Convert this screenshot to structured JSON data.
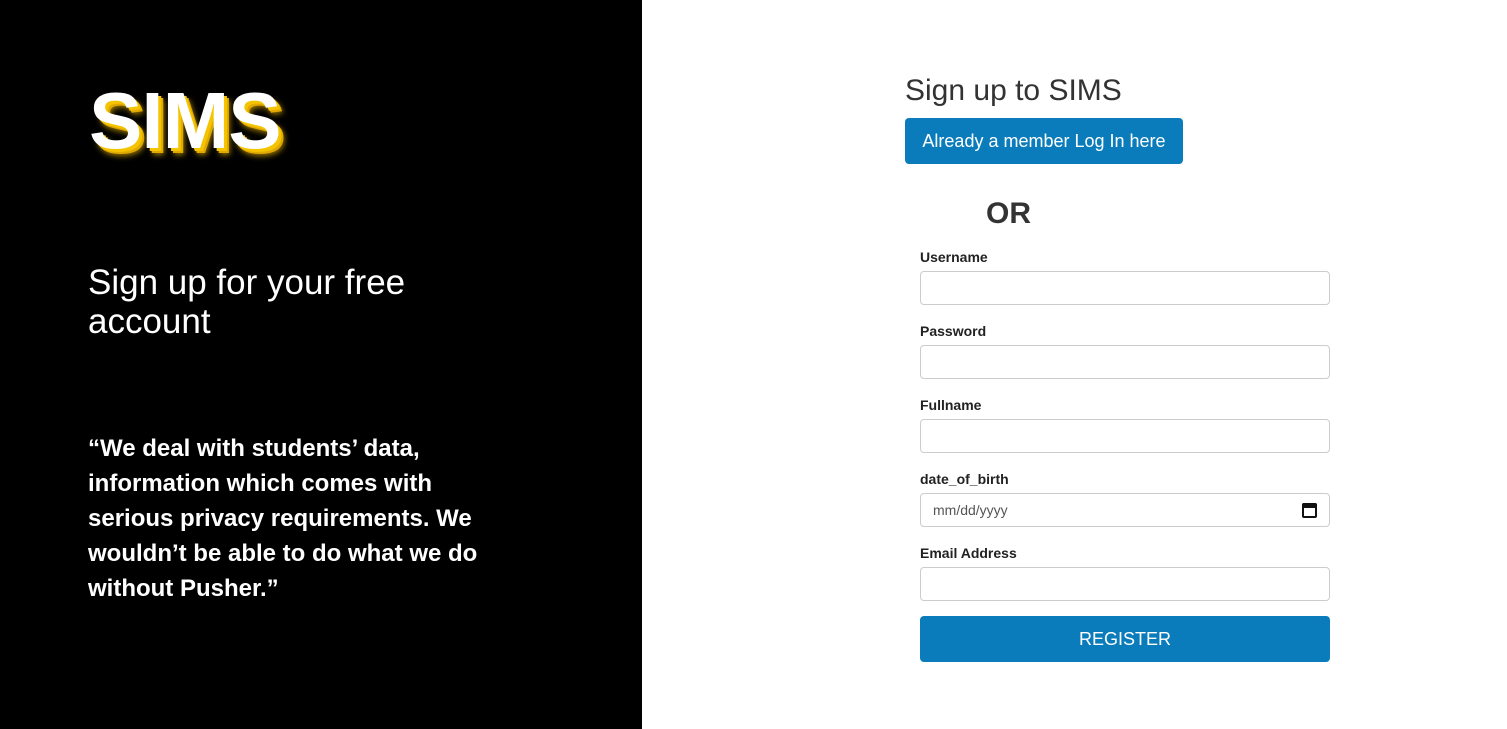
{
  "brand": {
    "logo_text": "SIMS",
    "accent_color": "#f5c400"
  },
  "left": {
    "tagline": "Sign up for your free account",
    "quote": "“We deal with students’ data, information which comes with serious privacy requirements. We wouldn’t be able to do what we do without Pusher.”"
  },
  "form": {
    "title": "Sign up to SIMS",
    "login_button": "Already a member Log In here",
    "or_label": "OR",
    "fields": {
      "username": {
        "label": "Username",
        "value": ""
      },
      "password": {
        "label": "Password",
        "value": ""
      },
      "fullname": {
        "label": "Fullname",
        "value": ""
      },
      "date_of_birth": {
        "label": "date_of_birth",
        "placeholder": "mm/dd/yyyy",
        "icon": "calendar-icon"
      },
      "email": {
        "label": "Email Address",
        "value": ""
      }
    },
    "register_button": "REGISTER",
    "button_color": "#0a7cbb"
  }
}
